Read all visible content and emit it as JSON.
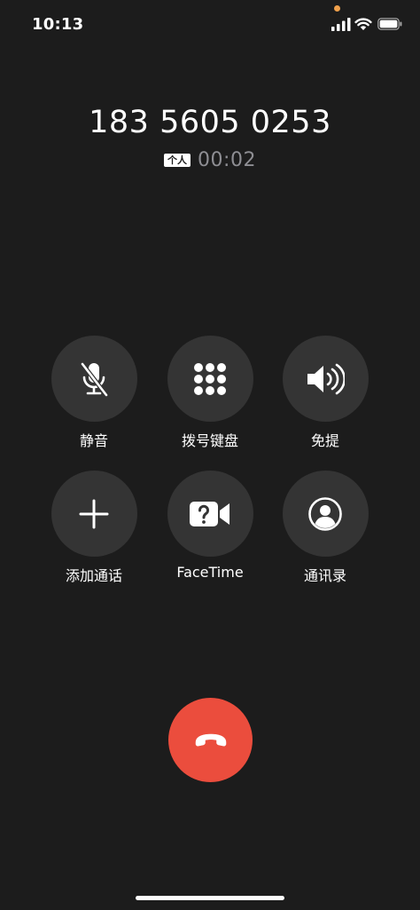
{
  "status_bar": {
    "time": "10:13",
    "signal_icon": "cellular-signal-icon",
    "wifi_icon": "wifi-icon",
    "battery_icon": "battery-icon",
    "mic_indicator_color": "#f0a04b"
  },
  "call": {
    "number": "183 5605 0253",
    "label": "个人",
    "duration": "00:02"
  },
  "controls": [
    {
      "label": "静音",
      "icon": "mic-muted-icon"
    },
    {
      "label": "拨号键盘",
      "icon": "keypad-icon"
    },
    {
      "label": "免提",
      "icon": "speaker-icon"
    },
    {
      "label": "添加通话",
      "icon": "plus-icon"
    },
    {
      "label": "FaceTime",
      "icon": "facetime-video-icon"
    },
    {
      "label": "通讯录",
      "icon": "contacts-icon"
    }
  ],
  "end_call": {
    "icon": "hang-up-icon",
    "color": "#eb4d3d"
  },
  "colors": {
    "background": "#1c1c1c",
    "button": "#343434",
    "secondary_text": "#8e8e93"
  }
}
